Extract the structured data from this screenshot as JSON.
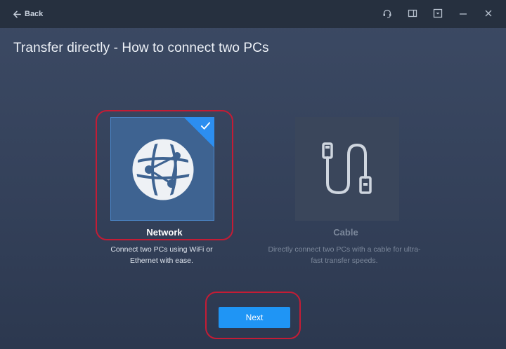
{
  "titlebar": {
    "back_label": "Back",
    "icons": [
      "support-icon",
      "feedback-icon",
      "menu-icon",
      "minimize-icon",
      "close-icon"
    ]
  },
  "page": {
    "title": "Transfer directly - How to connect two PCs"
  },
  "options": [
    {
      "label": "Network",
      "description": "Connect two PCs using WiFi or Ethernet with ease.",
      "icon": "globe-icon",
      "selected": true
    },
    {
      "label": "Cable",
      "description": "Directly connect two PCs with a cable for ultra-fast transfer speeds.",
      "icon": "usb-cable-icon",
      "selected": false
    }
  ],
  "actions": {
    "next_label": "Next"
  },
  "colors": {
    "accent": "#1f95f5",
    "highlight": "#c41c35",
    "selected_tile": "#3e6391"
  }
}
